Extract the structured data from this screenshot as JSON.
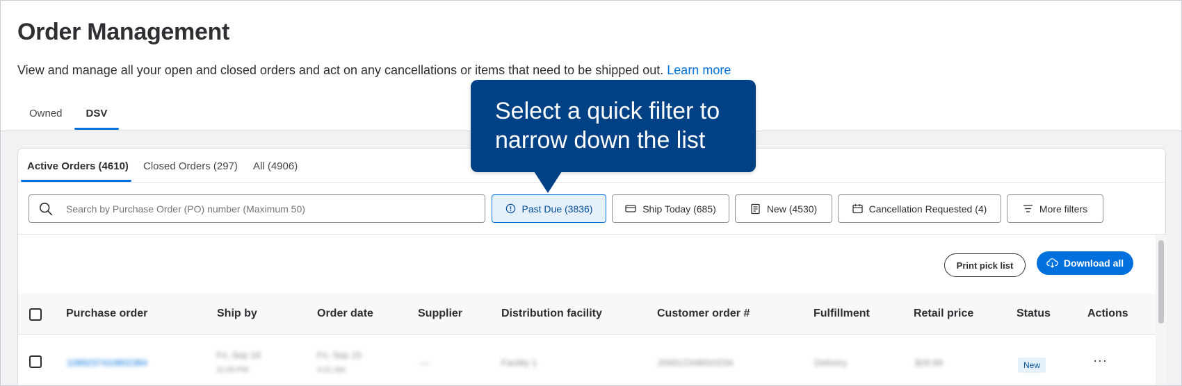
{
  "page": {
    "title": "Order Management",
    "description": "View and manage all your open and closed orders and act on any cancellations or items that need to be shipped out.",
    "learn_more": "Learn more"
  },
  "top_tabs": [
    {
      "label": "Owned",
      "active": false
    },
    {
      "label": "DSV",
      "active": true
    }
  ],
  "order_tabs": [
    {
      "label": "Active Orders (4610)",
      "active": true
    },
    {
      "label": "Closed Orders (297)",
      "active": false
    },
    {
      "label": "All (4906)",
      "active": false
    }
  ],
  "search": {
    "placeholder": "Search by Purchase Order (PO) number (Maximum 50)",
    "icon": "search-icon"
  },
  "quick_filters": [
    {
      "label": "Past Due (3836)",
      "icon": "alert-circle-icon",
      "selected": true
    },
    {
      "label": "Ship Today (685)",
      "icon": "truck-icon",
      "selected": false
    },
    {
      "label": "New (4530)",
      "icon": "document-icon",
      "selected": false
    },
    {
      "label": "Cancellation Requested (4)",
      "icon": "calendar-x-icon",
      "selected": false
    },
    {
      "label": "More filters",
      "icon": "filter-lines-icon",
      "selected": false
    }
  ],
  "buttons": {
    "print_pick_list": "Print pick list",
    "download_all": "Download all"
  },
  "table": {
    "columns": [
      "Purchase order",
      "Ship by",
      "Order date",
      "Supplier",
      "Distribution facility",
      "Customer order #",
      "Fulfillment",
      "Retail price",
      "Status",
      "Actions"
    ],
    "rows": [
      {
        "status": "New",
        "actions": "···"
      }
    ]
  },
  "tooltip": {
    "line1": "Select a quick filter to",
    "line2": "narrow down the list"
  },
  "colors": {
    "accent": "#0071dc",
    "tooltip_bg": "#004185",
    "selected_chip_bg": "#e5f0fb"
  }
}
